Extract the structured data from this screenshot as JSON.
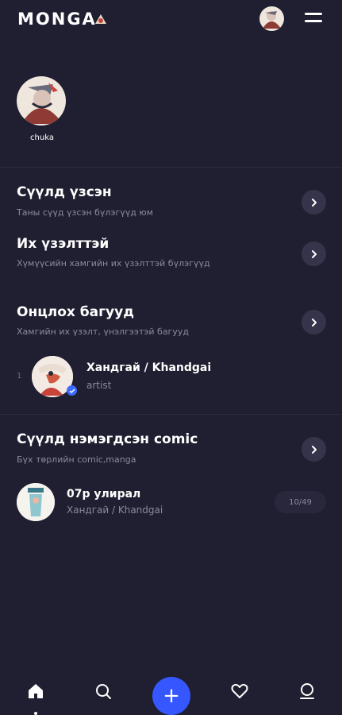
{
  "header": {
    "logo": "MONGA",
    "menu_icon": "hamburger-menu-icon",
    "avatar_icon": "user-avatar"
  },
  "profile": {
    "name": "chuka"
  },
  "sections": {
    "recent": {
      "title": "Сүүлд үзсэн",
      "subtitle": "Таны сүүд үзсэн бүлэгүүд юм"
    },
    "popular": {
      "title": "Их үзэлттэй",
      "subtitle": "Хүмүүсийн хамгийн их үзэлттэй бүлэгүүд"
    },
    "featured_teams": {
      "title": "Онцлох багууд",
      "subtitle": "Хамгийн их үзэлт, үнэлгээтэй багууд",
      "items": [
        {
          "rank": "1",
          "name": "Хандгай / Khandgai",
          "role": "artist",
          "verified": true
        }
      ]
    },
    "new_comics": {
      "title": "Сүүлд нэмэгдсэн comic",
      "subtitle": "Бүх төрлийн comic,manga",
      "items": [
        {
          "title": "07р улирал",
          "author": "Хандгай / Khandgai",
          "progress": "10/49"
        }
      ]
    }
  },
  "bottom_nav": {
    "items": [
      "home-icon",
      "search-icon",
      "add-icon",
      "heart-icon",
      "profile-icon"
    ],
    "active": "home-icon",
    "add_label": "+"
  },
  "colors": {
    "background": "#201f31",
    "accent": "#3657ff",
    "button": "#35344a",
    "muted_text": "#8a8aa0"
  }
}
